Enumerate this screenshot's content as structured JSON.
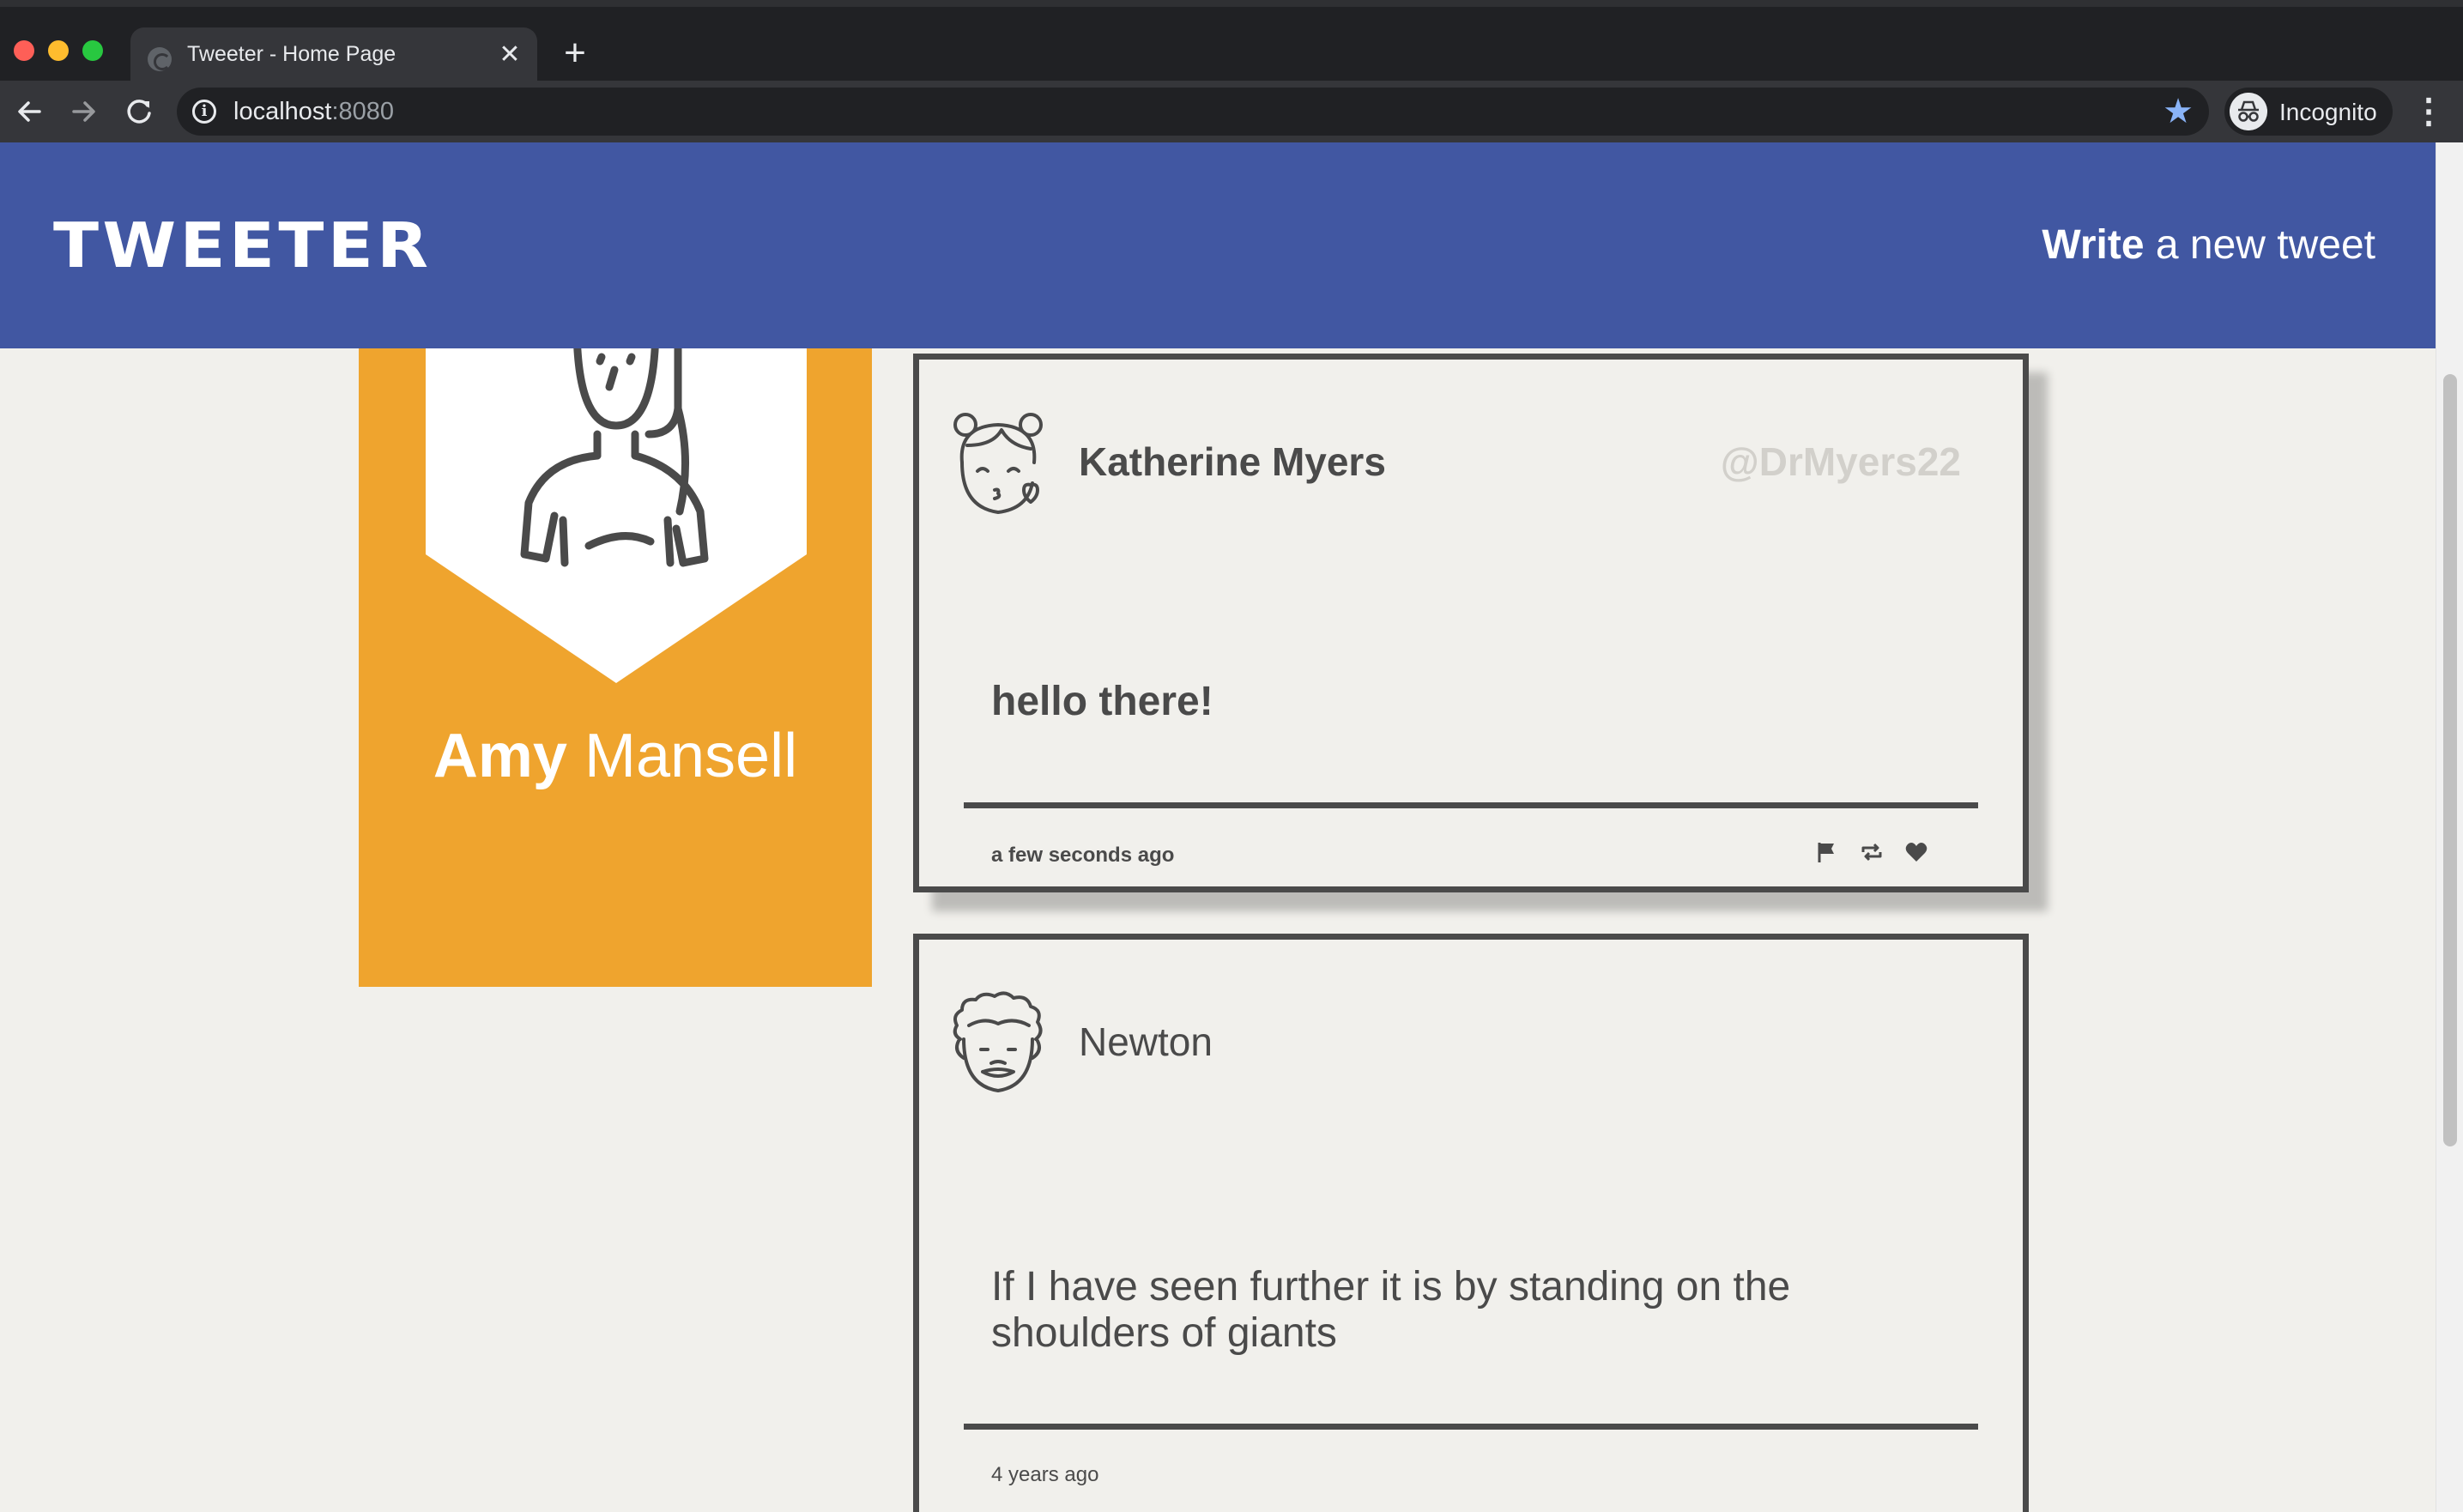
{
  "browser": {
    "tab_title": "Tweeter - Home Page",
    "tab_close": "✕",
    "new_tab": "+",
    "url_host": "localhost",
    "url_port": ":8080",
    "profile_label": "Incognito",
    "star_color": "#8ab4f8",
    "menu": "⋮"
  },
  "header": {
    "logo": "TWEETER",
    "compose_bold": "Write",
    "compose_rest": " a new tweet",
    "background": "#4157a2"
  },
  "profile": {
    "first_name": "Amy",
    "last_name": " Mansell",
    "card_color": "#efa42e",
    "avatar_icon": "woman-avatar-icon"
  },
  "tweets": [
    {
      "name": "Katherine Myers",
      "handle": "@DrMyers22",
      "text": "hello there!",
      "time": "a few seconds ago",
      "avatar_icon": "girl-kiss-avatar-icon",
      "actions": [
        "flag-icon",
        "retweet-icon",
        "heart-icon"
      ]
    },
    {
      "name": "Newton",
      "handle": "",
      "text": "If I have seen further it is by standing on the shoulders of giants",
      "time": "4 years ago",
      "avatar_icon": "curly-hair-man-avatar-icon"
    }
  ]
}
